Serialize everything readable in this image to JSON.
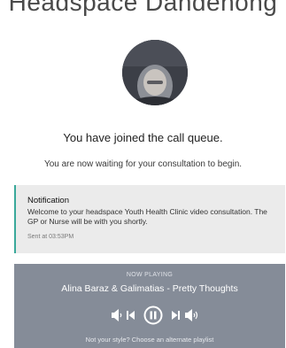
{
  "header": {
    "clinic_title": "Headspace Dandenong"
  },
  "queue": {
    "heading": "You have joined the call queue.",
    "subtext": "You are now waiting for your consultation to begin."
  },
  "notification": {
    "title": "Notification",
    "body": "Welcome to your headspace Youth Health Clinic video consultation. The GP or Nurse will be with you shortly.",
    "time": "Sent at 03:53PM"
  },
  "player": {
    "label": "NOW PLAYING",
    "track": "Alina Baraz & Galimatias - Pretty Thoughts",
    "playlist_note": "Not your style? Choose an alternate playlist",
    "controls": [
      "volume-down-icon",
      "previous-icon",
      "pause-icon",
      "next-icon",
      "volume-up-icon"
    ]
  },
  "colors": {
    "accent": "#3aa99b",
    "player_background": "#858c98",
    "notification_background": "#ebebeb"
  }
}
